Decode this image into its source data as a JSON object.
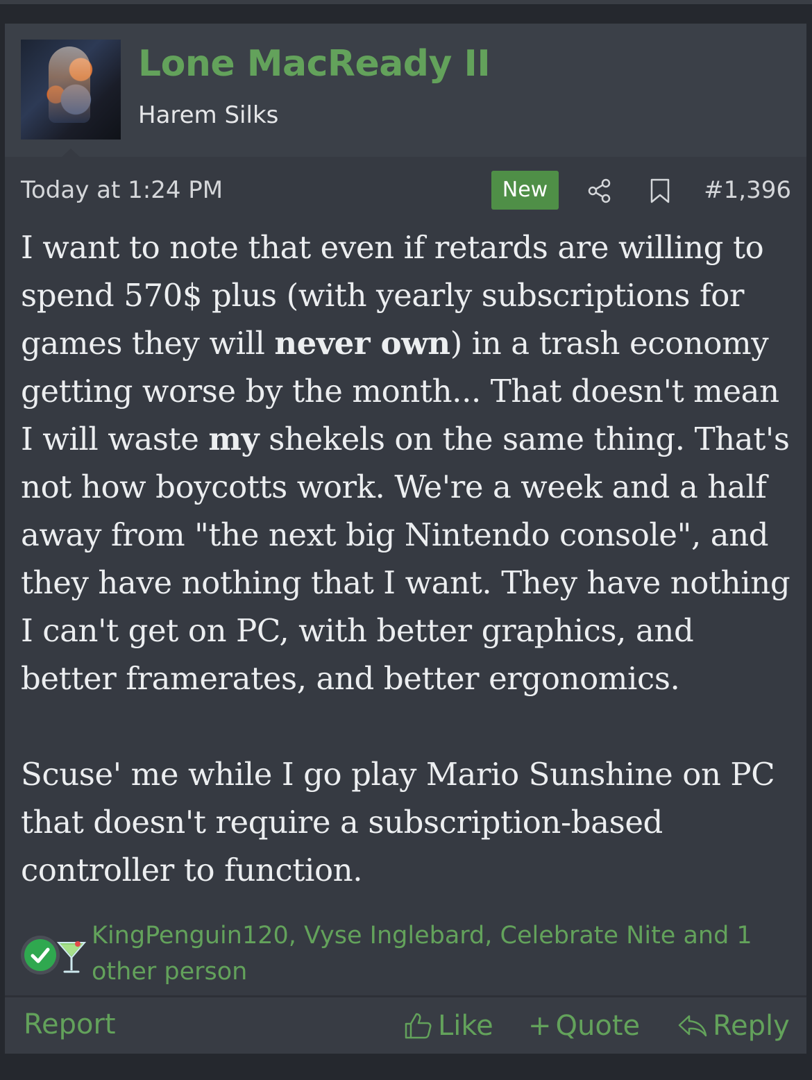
{
  "post": {
    "author": {
      "name": "Lone MacReady II",
      "title": "Harem Silks"
    },
    "date": "Today at 1:24 PM",
    "badge": "New",
    "number": "#1,396",
    "body": {
      "p1_a": "I want to note that even if retards are willing to spend 570$ plus (with yearly subscriptions for games they will ",
      "p1_bold1": "never own",
      "p1_b": ") in a trash economy getting worse by the month... That doesn't mean I will waste ",
      "p1_bold2": "my",
      "p1_c": " shekels on the same thing. That's not how boycotts work. We're a week and a half away from \"the next big Nintendo console\", and they have nothing that I want. They have nothing I can't get on PC, with better graphics, and better framerates, and better ergonomics.",
      "p2": "Scuse' me while I go play Mario Sunshine on PC that doesn't require a subscription-based controller to function."
    },
    "reactions": {
      "names": "KingPenguin120, Vyse Inglebard, Celebrate Nite and 1 other person",
      "icons": [
        "check-reaction-icon",
        "cocktail-reaction-icon"
      ]
    },
    "footer": {
      "report": "Report",
      "like": "Like",
      "quote": "Quote",
      "reply": "Reply"
    }
  },
  "colors": {
    "accent": "#63a25b",
    "badge": "#4f8f47",
    "card_bg": "#363a42",
    "header_bg": "#3b4048",
    "page_bg": "#25282e",
    "text": "#eceef0"
  }
}
